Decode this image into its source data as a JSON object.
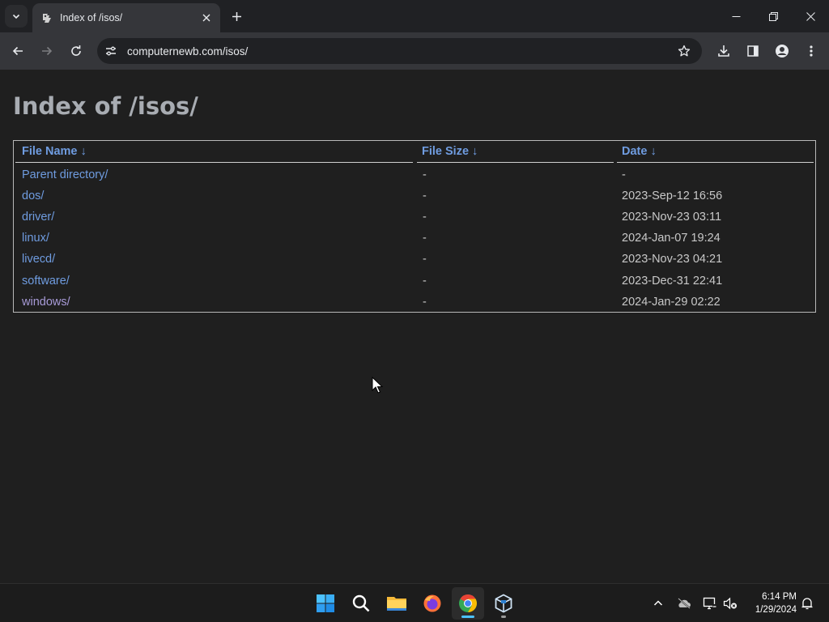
{
  "browser": {
    "tab_title": "Index of /isos/",
    "url": "computernewb.com/isos/"
  },
  "page": {
    "heading": "Index of /isos/",
    "columns": {
      "name": "File Name  ↓",
      "size": "File Size  ↓",
      "date": "Date  ↓"
    },
    "rows": [
      {
        "name": "Parent directory/",
        "size": "-",
        "date": "-"
      },
      {
        "name": "dos/",
        "size": "-",
        "date": "2023-Sep-12 16:56"
      },
      {
        "name": "driver/",
        "size": "-",
        "date": "2023-Nov-23 03:11"
      },
      {
        "name": "linux/",
        "size": "-",
        "date": "2024-Jan-07 19:24"
      },
      {
        "name": "livecd/",
        "size": "-",
        "date": "2023-Nov-23 04:21"
      },
      {
        "name": "software/",
        "size": "-",
        "date": "2023-Dec-31 22:41"
      },
      {
        "name": "windows/",
        "size": "-",
        "date": "2024-Jan-29 02:22"
      }
    ],
    "link_color": "#6f9ce0",
    "visited_link_color": "#a89bd8"
  },
  "taskbar": {
    "apps": [
      "windows-start-icon",
      "search-icon",
      "file-explorer-icon",
      "firefox-icon",
      "chrome-icon",
      "virtualbox-icon"
    ],
    "time": "6:14 PM",
    "date": "1/29/2024"
  }
}
